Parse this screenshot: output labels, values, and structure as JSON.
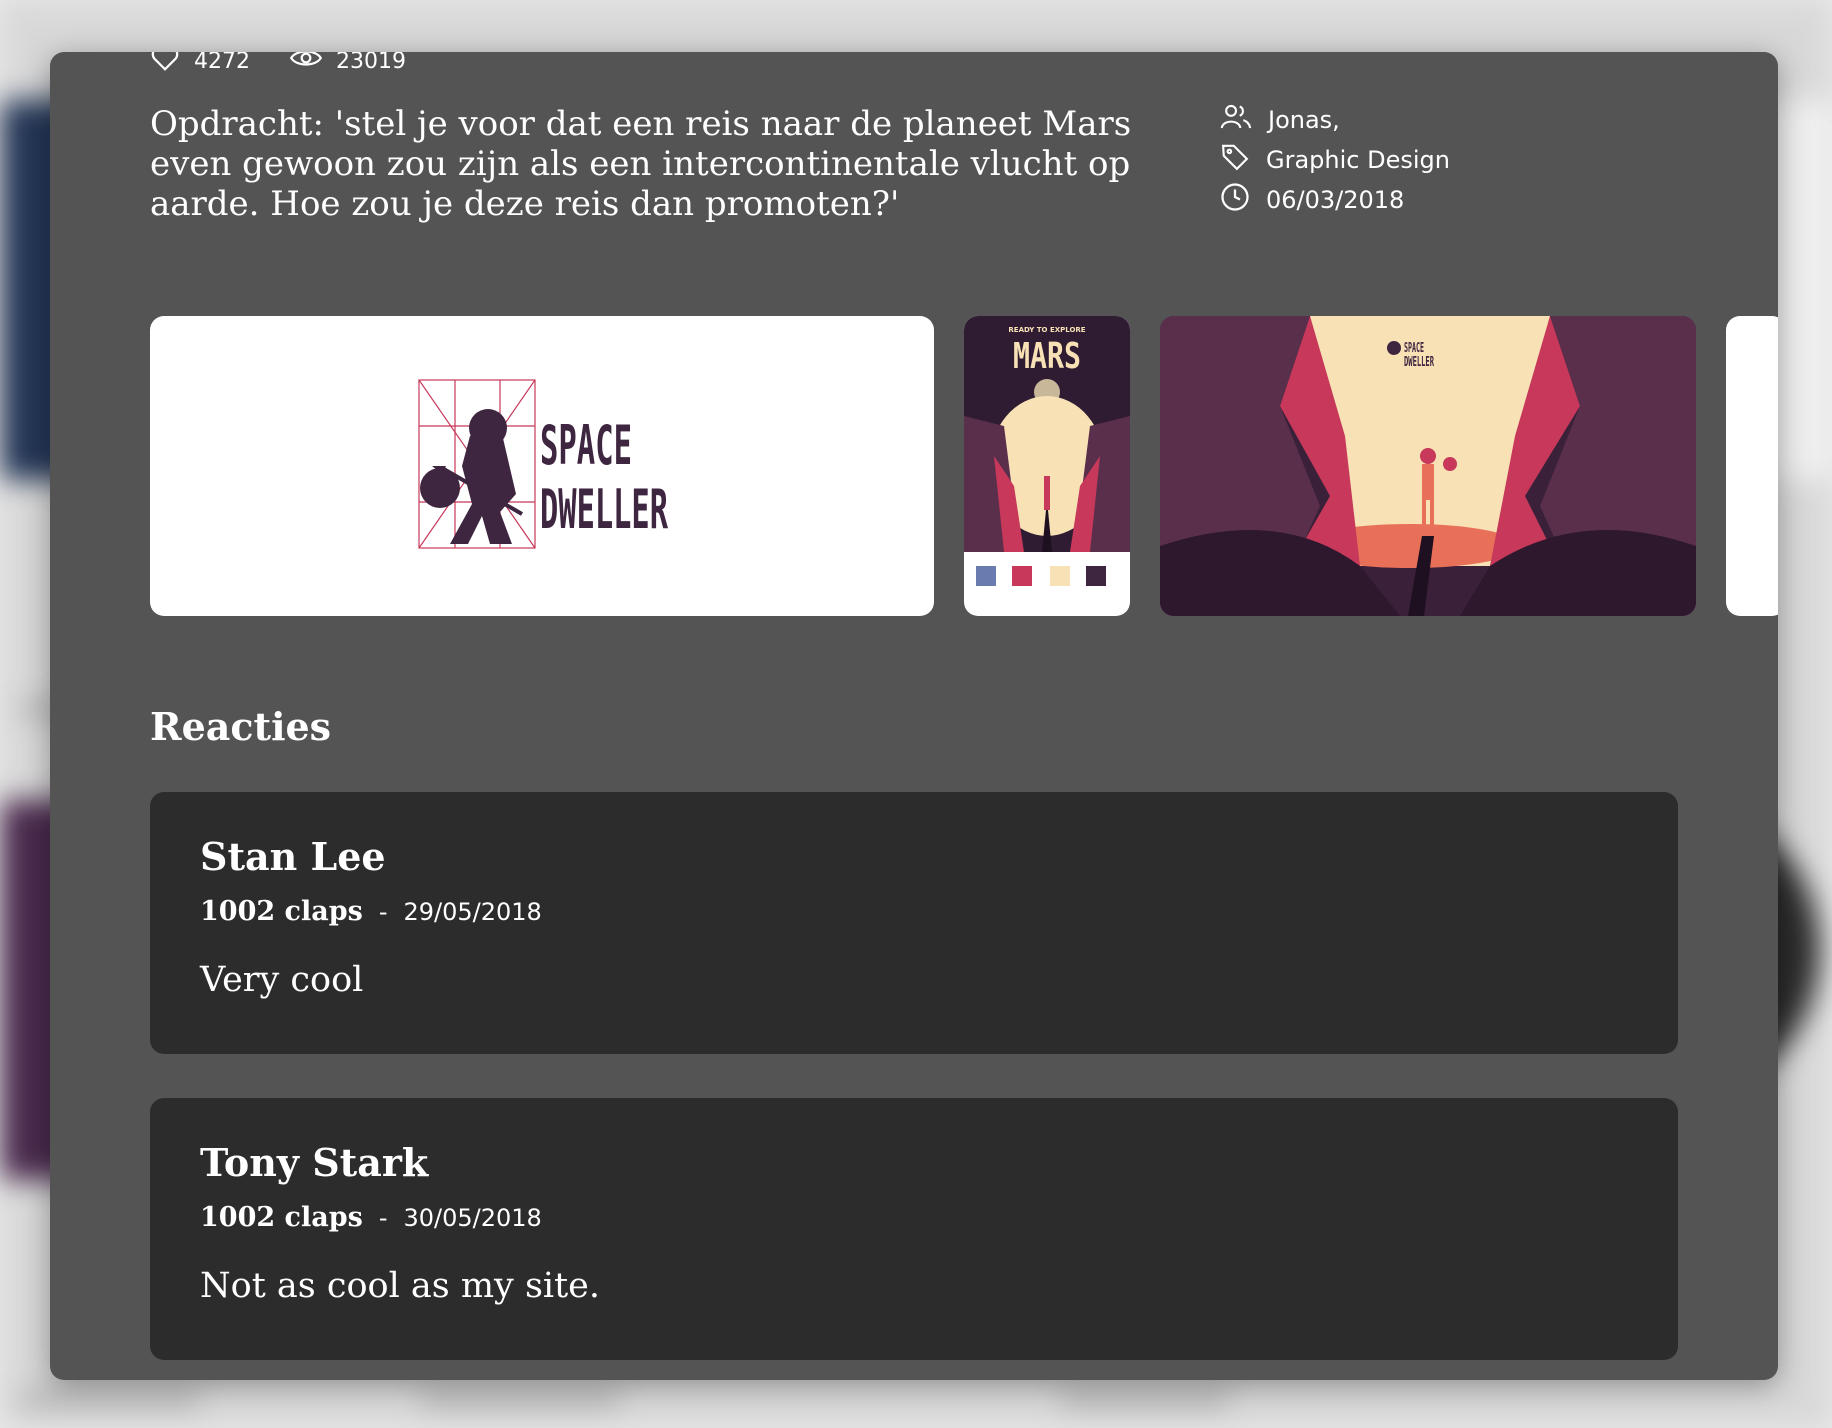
{
  "project": {
    "likes": "4272",
    "views": "23019",
    "description": "Opdracht: 'stel je voor dat een reis naar de planeet Mars even gewoon zou zijn als een intercontinentale vlucht op aarde. Hoe zou je deze reis dan promoten?'",
    "author": "Jonas,",
    "category": "Graphic Design",
    "date": "06/03/2018"
  },
  "gallery": {
    "logo_word_1": "SPACE",
    "logo_word_2": "DWELLER",
    "poster_tagline": "READY TO EXPLORE",
    "poster_title": "MARS",
    "scene_logo_1": "SPACE",
    "scene_logo_2": "DWELLER"
  },
  "comments_section": {
    "title": "Reacties",
    "separator": "-",
    "comments": [
      {
        "author": "Stan Lee",
        "claps": "1002 claps",
        "date": "29/05/2018",
        "text": "Very cool"
      },
      {
        "author": "Tony Stark",
        "claps": "1002 claps",
        "date": "30/05/2018",
        "text": "Not as cool as my site."
      }
    ]
  },
  "colors": {
    "modal_bg": "#545454",
    "card_bg": "#2c2c2c",
    "brand_plum": "#3e2540",
    "brand_red": "#c7385a",
    "sand": "#f7e1b5"
  }
}
